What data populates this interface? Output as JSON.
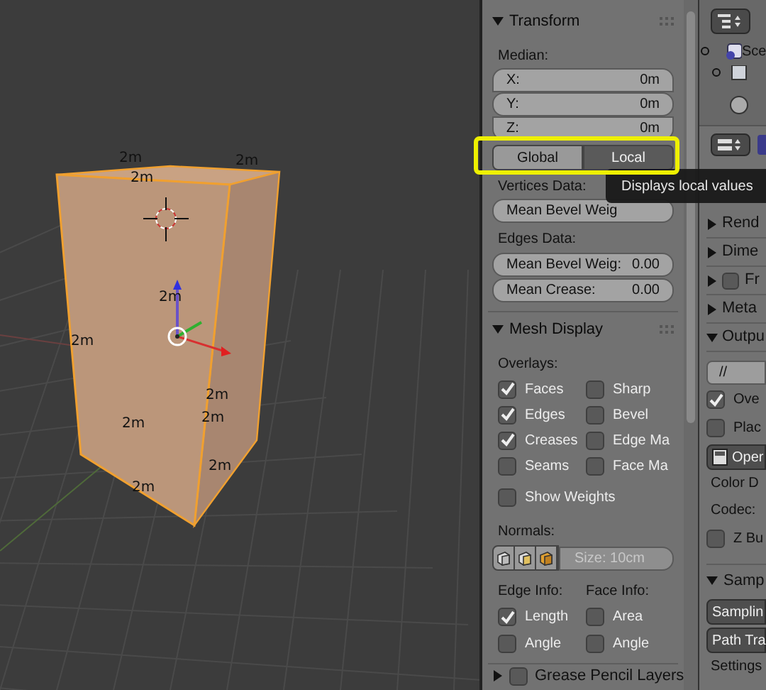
{
  "viewport": {
    "edge_labels": [
      "2m",
      "2m",
      "2m",
      "2m",
      "2m",
      "2m",
      "2m",
      "2m",
      "2m",
      "2m"
    ]
  },
  "transform": {
    "title": "Transform",
    "median_label": "Median:",
    "fields": [
      {
        "label": "X:",
        "value": "0m"
      },
      {
        "label": "Y:",
        "value": "0m"
      },
      {
        "label": "Z:",
        "value": "0m"
      }
    ],
    "space_toggle": [
      {
        "label": "Global",
        "selected": false
      },
      {
        "label": "Local",
        "selected": true
      }
    ],
    "vertices_label": "Vertices Data:",
    "vertices_fields": [
      {
        "label": "Mean Bevel Weig"
      }
    ],
    "edges_label": "Edges Data:",
    "edges_fields": [
      {
        "label": "Mean Bevel Weig:",
        "value": "0.00"
      },
      {
        "label": "Mean Crease:",
        "value": "0.00"
      }
    ]
  },
  "tooltip": {
    "text": "Displays local values"
  },
  "mesh_display": {
    "title": "Mesh Display",
    "overlays_label": "Overlays:",
    "overlays": [
      {
        "label": "Faces",
        "checked": true
      },
      {
        "label": "Sharp",
        "checked": false
      },
      {
        "label": "Edges",
        "checked": true
      },
      {
        "label": "Bevel",
        "checked": false
      },
      {
        "label": "Creases",
        "checked": true
      },
      {
        "label": "Edge Ma",
        "checked": false
      },
      {
        "label": "Seams",
        "checked": false
      },
      {
        "label": "Face Ma",
        "checked": false
      }
    ],
    "show_weights": {
      "label": "Show Weights",
      "checked": false
    },
    "normals_label": "Normals:",
    "normals_size": "Size: 10cm",
    "edge_info_label": "Edge Info:",
    "face_info_label": "Face Info:",
    "info_rows": [
      {
        "label": "Length",
        "checked": true
      },
      {
        "label": "Area",
        "checked": false
      },
      {
        "label": "Angle",
        "checked": false
      },
      {
        "label": "Angle",
        "checked": false
      }
    ]
  },
  "grease_pencil": {
    "title": "Grease Pencil Layers",
    "checked": false
  },
  "outliner": {
    "items": [
      {
        "label": "Sce"
      }
    ]
  },
  "properties": {
    "sections": [
      {
        "title": "Rend",
        "expanded": false
      },
      {
        "title": "Dime",
        "expanded": false
      },
      {
        "title": "Fr",
        "expanded": false,
        "kind": "check",
        "checked": false
      },
      {
        "title": "Meta",
        "expanded": false
      },
      {
        "title": "Outpu",
        "expanded": true
      }
    ],
    "output_path": "//",
    "output_rows": [
      {
        "kind": "check",
        "label": "Ove",
        "checked": true
      },
      {
        "kind": "check",
        "label": "Plac",
        "checked": false
      },
      {
        "kind": "button",
        "label": "Oper"
      },
      {
        "kind": "label",
        "label": "Color D"
      },
      {
        "kind": "label",
        "label": "Codec:"
      },
      {
        "kind": "check",
        "label": "Z Bu",
        "checked": false
      }
    ],
    "sampling_title": "Samp",
    "sampling_rows": [
      {
        "kind": "button",
        "label": "Samplin"
      },
      {
        "kind": "button",
        "label": "Path Tra"
      },
      {
        "kind": "label",
        "label": "Settings"
      }
    ]
  }
}
